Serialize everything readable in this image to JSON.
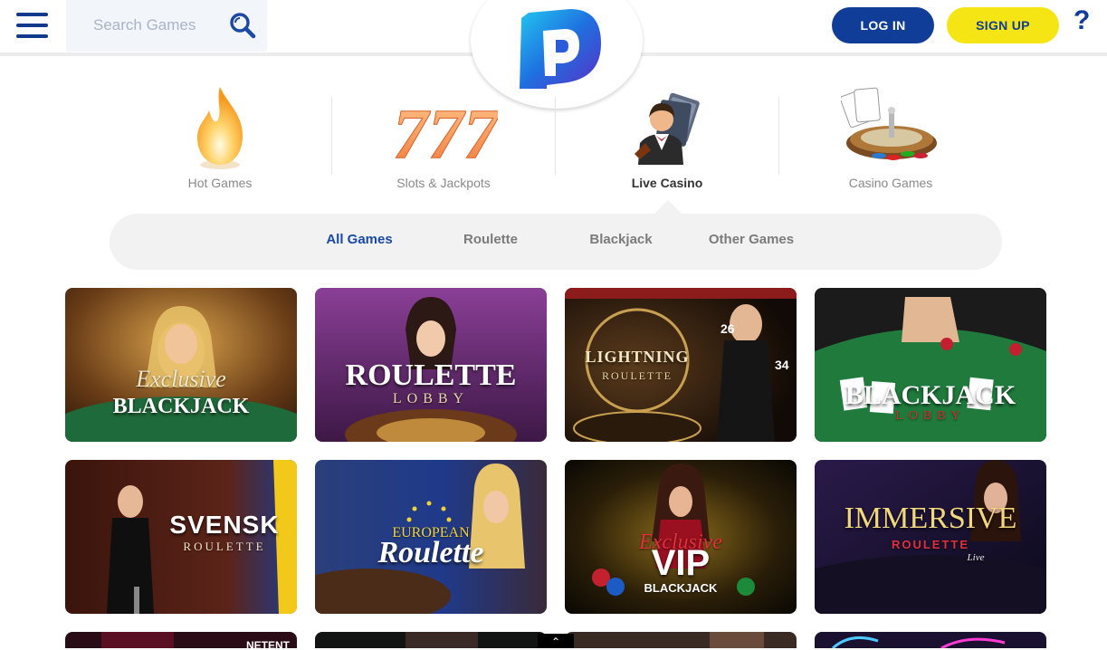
{
  "search": {
    "placeholder": "Search Games"
  },
  "header": {
    "login_label": "LOG IN",
    "signup_label": "SIGN UP",
    "help_label": "?"
  },
  "categories": [
    {
      "label": "Hot Games",
      "icon": "flame-icon",
      "active": false
    },
    {
      "label": "Slots & Jackpots",
      "icon": "triple-seven-icon",
      "active": false
    },
    {
      "label": "Live Casino",
      "icon": "dealer-icon",
      "active": true
    },
    {
      "label": "Casino Games",
      "icon": "roulette-wheel-icon",
      "active": false
    }
  ],
  "subtabs": [
    {
      "label": "All Games",
      "active": true
    },
    {
      "label": "Roulette",
      "active": false
    },
    {
      "label": "Blackjack",
      "active": false
    },
    {
      "label": "Other Games",
      "active": false
    }
  ],
  "games": [
    {
      "title": "BLACKJACK",
      "sub": "Exclusive"
    },
    {
      "title": "ROULETTE",
      "sub": "LOBBY"
    },
    {
      "title": "LIGHTNING",
      "sub": "ROULETTE"
    },
    {
      "title": "BLACKJACK",
      "sub": "LOBBY"
    },
    {
      "title": "SVENSK",
      "sub": "ROULETTE"
    },
    {
      "title": "Roulette",
      "sub": "EUROPEAN"
    },
    {
      "title": "VIP",
      "sub": "Exclusive",
      "sub2": "BLACKJACK"
    },
    {
      "title": "IMMERSIVE",
      "sub": "ROULETTE",
      "sub2": "Live"
    }
  ],
  "partial_tile": {
    "brand": "NETENT"
  },
  "colors": {
    "brand_blue": "#0f3d98",
    "signup_yellow": "#f6e515",
    "active_tab": "#1a4aa5"
  }
}
